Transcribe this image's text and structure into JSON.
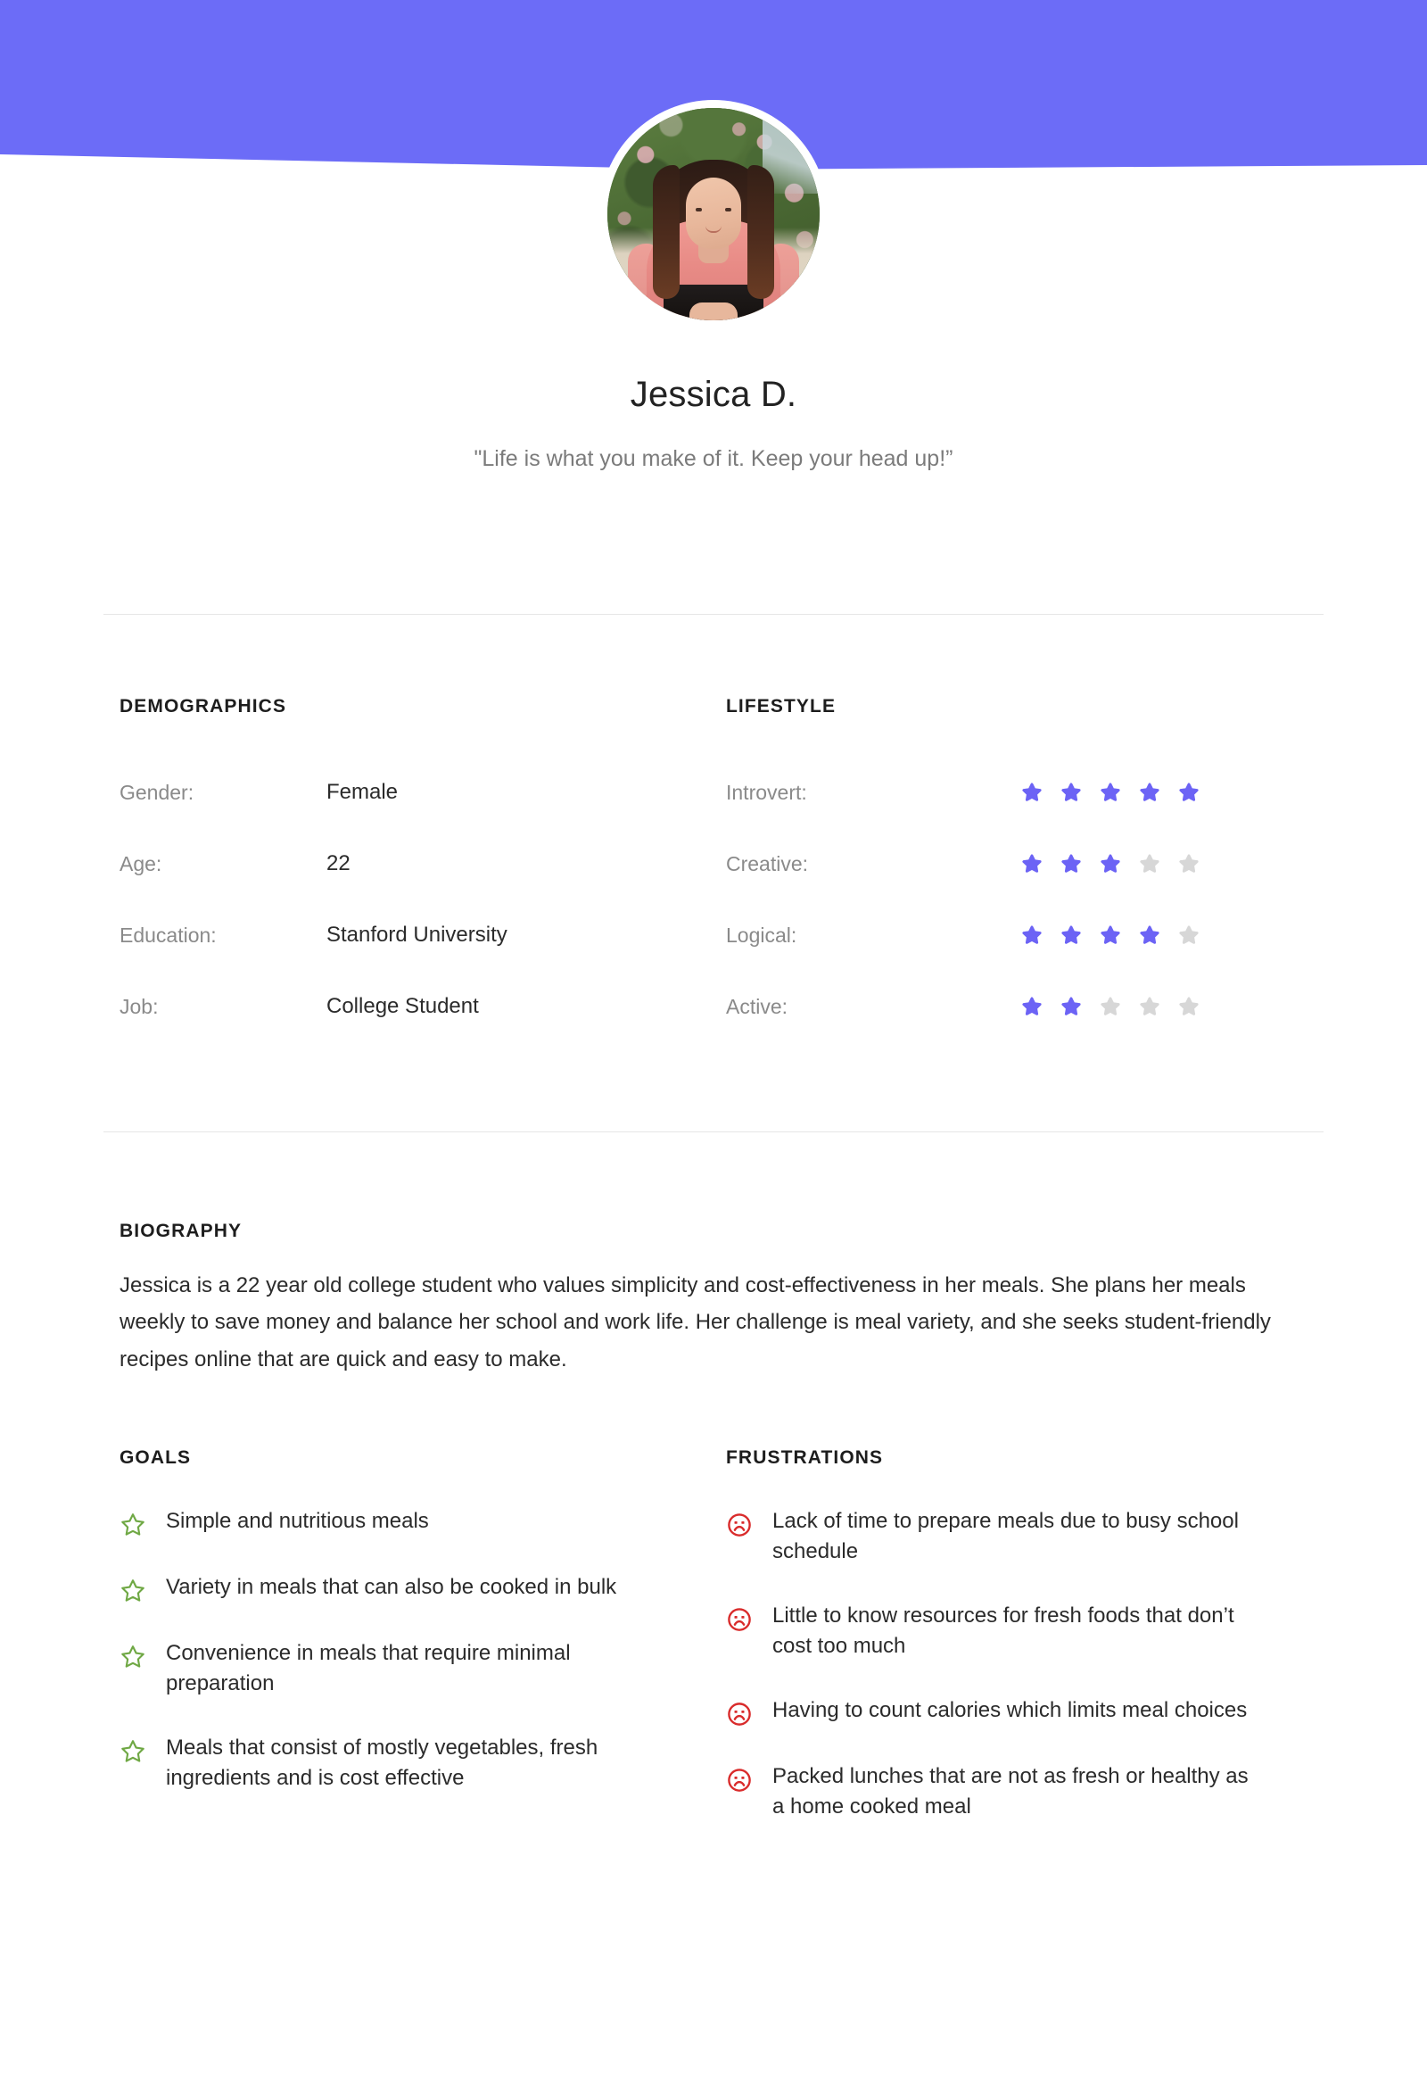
{
  "theme": {
    "banner_color": "#6C6CF7",
    "accent_purple": "#6C63F5",
    "star_empty": "#D7D7D7",
    "goal_green": "#6FA844",
    "frustration_red": "#D92B2B",
    "text_dark": "#2b2b2b",
    "text_muted": "#8a8a8a",
    "divider": "#e6e6e6"
  },
  "header": {
    "avatar_icon": "user-avatar-photo",
    "avatar_alt": "Portrait of a young woman with long auburn hair wearing a pink top, seated in front of green flowering shrubs"
  },
  "identity": {
    "name": "Jessica D.",
    "quote": "\"Life is what you make of it. Keep your head up!”"
  },
  "demographics": {
    "title": "DEMOGRAPHICS",
    "rows": [
      {
        "key": "Gender:",
        "value": "Female"
      },
      {
        "key": "Age:",
        "value": "22"
      },
      {
        "key": "Education:",
        "value": "Stanford University"
      },
      {
        "key": "Job:",
        "value": "College Student"
      }
    ]
  },
  "lifestyle": {
    "title": "LIFESTYLE",
    "max_rating": 5,
    "rows": [
      {
        "key": "Introvert:",
        "rating": 5
      },
      {
        "key": "Creative:",
        "rating": 3
      },
      {
        "key": "Logical:",
        "rating": 4
      },
      {
        "key": "Active:",
        "rating": 2
      }
    ]
  },
  "biography": {
    "title": "BIOGRAPHY",
    "text": "Jessica is a 22 year old college student who values simplicity and cost-effectiveness in her meals. She plans her meals weekly to save money and balance her school and work life. Her challenge is meal variety, and she seeks student-friendly recipes online that are quick and easy to make."
  },
  "goals": {
    "title": "GOALS",
    "icon": "star-outline-icon",
    "items": [
      "Simple and nutritious meals",
      "Variety in meals that can also be cooked in bulk",
      "Convenience in meals that require minimal preparation",
      "Meals that consist of mostly vegetables, fresh ingredients and is cost effective"
    ]
  },
  "frustrations": {
    "title": "FRUSTRATIONS",
    "icon": "sad-face-icon",
    "items": [
      "Lack of time to prepare meals due to busy school schedule",
      "Little to know resources for fresh foods that don’t cost too much",
      "Having to count calories which limits meal choices",
      "Packed lunches that are not as fresh or healthy as a home cooked meal"
    ]
  }
}
